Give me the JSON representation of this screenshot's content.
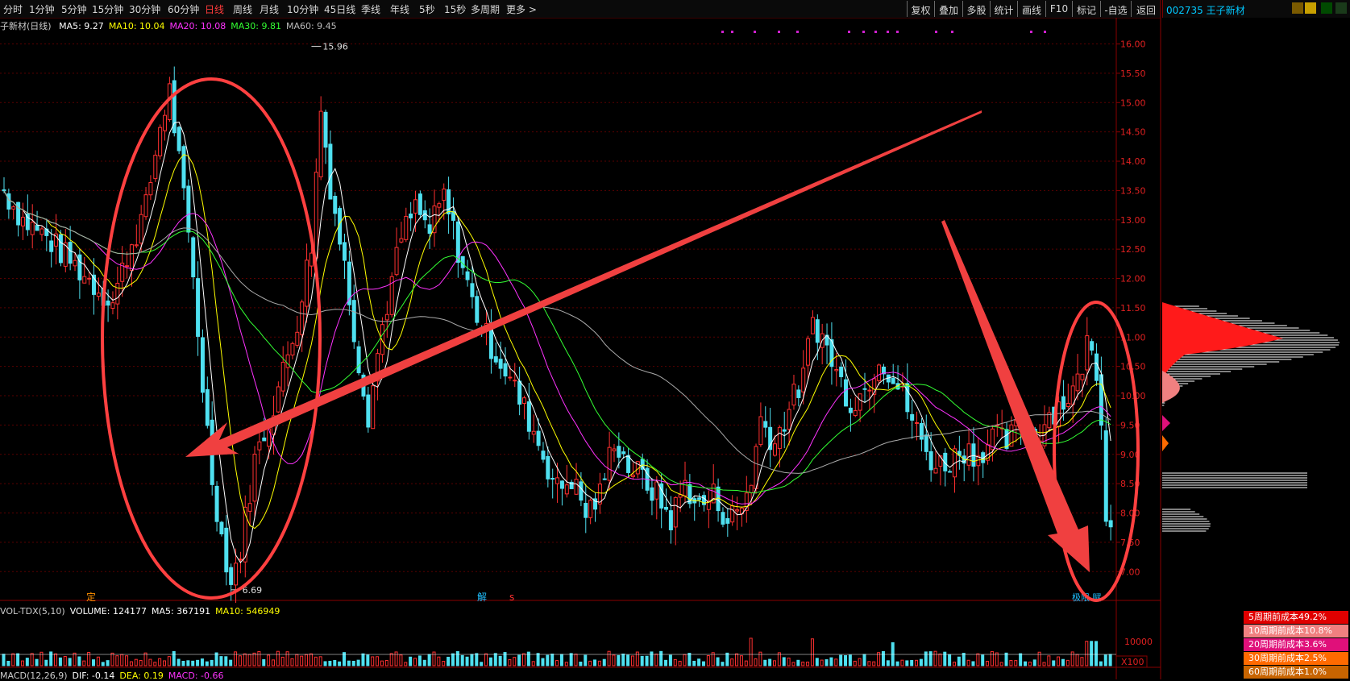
{
  "toolbar": {
    "periods": [
      "分时",
      "1分钟",
      "5分钟",
      "15分钟",
      "30分钟",
      "60分钟",
      "日线",
      "周线",
      "月线",
      "10分钟",
      "45日线",
      "季线",
      "年线",
      "5秒",
      "15秒",
      "多周期",
      "更多 >"
    ],
    "active_period": "日线",
    "tools": [
      "复权",
      "叠加",
      "多股",
      "统计",
      "画线",
      "F10",
      "标记",
      "-自选",
      "返回"
    ]
  },
  "stock": {
    "code": "002735",
    "name": "王子新材",
    "chart_label": "子新材(日线)"
  },
  "ma_legend": [
    {
      "label": "MA5: 9.27",
      "color": "#ffffff"
    },
    {
      "label": "MA10: 10.04",
      "color": "#ffff00"
    },
    {
      "label": "MA20: 10.08",
      "color": "#ff33ff"
    },
    {
      "label": "MA30: 9.81",
      "color": "#33ff33"
    },
    {
      "label": "MA60: 9.45",
      "color": "#bbbbbb"
    }
  ],
  "volume_legend": [
    {
      "label": "VOL-TDX(5,10)",
      "color": "#cccccc"
    },
    {
      "label": "VOLUME: 124177",
      "color": "#ffffff"
    },
    {
      "label": "MA5: 367191",
      "color": "#ffffff"
    },
    {
      "label": "MA10: 546949",
      "color": "#ffff00"
    }
  ],
  "macd_legend": [
    {
      "label": "MACD(12,26,9)",
      "color": "#cccccc"
    },
    {
      "label": "DIF: -0.14",
      "color": "#ffffff"
    },
    {
      "label": "DEA: 0.19",
      "color": "#ffff00"
    },
    {
      "label": "MACD: -0.66",
      "color": "#ff33ff"
    }
  ],
  "markers": {
    "ding": "定",
    "jie": "解",
    "s": "s",
    "bottom_right": "极限 赋"
  },
  "cost_legend": [
    {
      "label": "5周期前成本49.2%",
      "color": "#e00000"
    },
    {
      "label": "10周期前成本10.8%",
      "color": "#f08080"
    },
    {
      "label": "20周期前成本3.6%",
      "color": "#e0107a"
    },
    {
      "label": "30周期前成本2.5%",
      "color": "#ff6a00"
    },
    {
      "label": "60周期前成本1.0%",
      "color": "#c86400"
    }
  ],
  "chart_data": {
    "type": "candlestick",
    "title": "子新材(日线)",
    "price_axis": {
      "ticks": [
        "16.00",
        "15.50",
        "15.00",
        "14.50",
        "14.00",
        "13.50",
        "13.00",
        "12.50",
        "12.00",
        "11.50",
        "11.00",
        "10.50",
        "10.00",
        "9.50",
        "9.00",
        "8.50",
        "8.00",
        "7.50",
        "7.00"
      ],
      "range": [
        6.55,
        16.2
      ]
    },
    "annotations": {
      "high_label": "15.96",
      "high_value": 15.96,
      "low_label": "6.69",
      "low_value": 6.69
    },
    "volume_axis": {
      "tick": "10000",
      "unit": "X100"
    },
    "price_path": [
      [
        0,
        13.5
      ],
      [
        4,
        13.0
      ],
      [
        9,
        12.7
      ],
      [
        14,
        12.3
      ],
      [
        19,
        11.9
      ],
      [
        23,
        11.6
      ],
      [
        26,
        12.4
      ],
      [
        30,
        13.2
      ],
      [
        33,
        14.6
      ],
      [
        35,
        15.2
      ],
      [
        37,
        14.0
      ],
      [
        40,
        12.0
      ],
      [
        42,
        10.2
      ],
      [
        44,
        8.6
      ],
      [
        46,
        7.6
      ],
      [
        48,
        6.8
      ],
      [
        50,
        7.4
      ],
      [
        53,
        8.9
      ],
      [
        56,
        9.6
      ],
      [
        59,
        10.4
      ],
      [
        62,
        11.3
      ],
      [
        65,
        12.6
      ],
      [
        67,
        14.9
      ],
      [
        69,
        13.6
      ],
      [
        72,
        12.2
      ],
      [
        75,
        10.6
      ],
      [
        77,
        9.7
      ],
      [
        80,
        11.2
      ],
      [
        84,
        12.7
      ],
      [
        87,
        13.2
      ],
      [
        90,
        12.8
      ],
      [
        93,
        13.4
      ],
      [
        96,
        12.5
      ],
      [
        99,
        11.6
      ],
      [
        102,
        11.0
      ],
      [
        105,
        10.6
      ],
      [
        108,
        10.1
      ],
      [
        111,
        9.6
      ],
      [
        114,
        9.0
      ],
      [
        117,
        8.4
      ],
      [
        120,
        8.6
      ],
      [
        123,
        8.0
      ],
      [
        126,
        8.3
      ],
      [
        129,
        9.3
      ],
      [
        132,
        8.8
      ],
      [
        135,
        8.6
      ],
      [
        138,
        8.3
      ],
      [
        141,
        7.9
      ],
      [
        144,
        8.5
      ],
      [
        147,
        8.1
      ],
      [
        150,
        8.3
      ],
      [
        153,
        7.9
      ],
      [
        156,
        8.1
      ],
      [
        158,
        8.6
      ],
      [
        160,
        9.6
      ],
      [
        163,
        9.2
      ],
      [
        166,
        9.8
      ],
      [
        169,
        10.3
      ],
      [
        171,
        11.3
      ],
      [
        173,
        11.0
      ],
      [
        176,
        10.4
      ],
      [
        179,
        9.9
      ],
      [
        182,
        10.1
      ],
      [
        185,
        10.7
      ],
      [
        188,
        10.3
      ],
      [
        191,
        9.8
      ],
      [
        194,
        9.2
      ],
      [
        197,
        8.8
      ],
      [
        200,
        8.9
      ],
      [
        203,
        9.1
      ],
      [
        206,
        9.0
      ],
      [
        209,
        9.3
      ],
      [
        212,
        9.2
      ],
      [
        215,
        9.5
      ],
      [
        218,
        9.3
      ],
      [
        221,
        9.7
      ],
      [
        224,
        9.9
      ],
      [
        227,
        10.2
      ],
      [
        229,
        10.9
      ],
      [
        231,
        10.5
      ],
      [
        232,
        9.6
      ],
      [
        233,
        8.1
      ],
      [
        234,
        7.9
      ]
    ]
  }
}
